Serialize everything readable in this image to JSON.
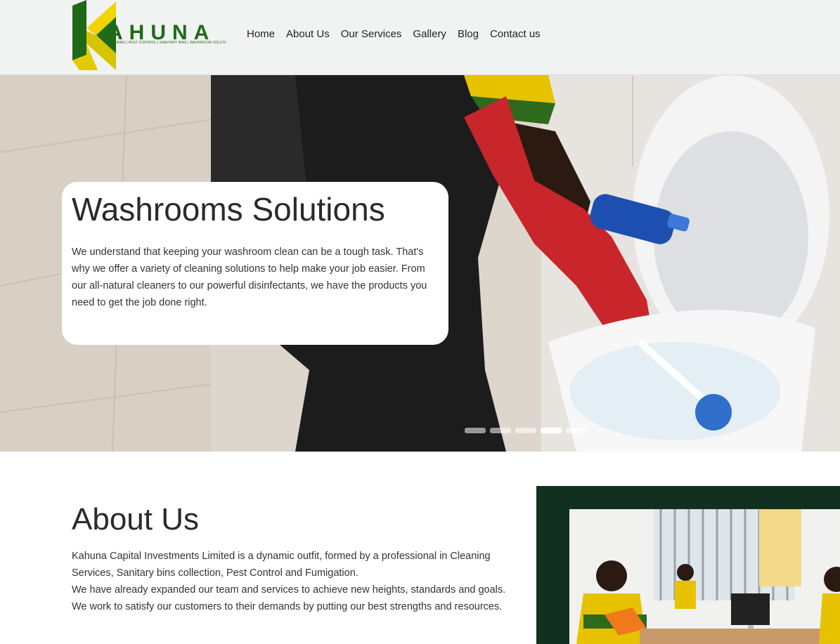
{
  "brand": {
    "name": "AHUNA",
    "tagline": "CLEANING | PEST CONTROL | SANITARY BINS | WASHROOM SOLUTIONS",
    "colors": {
      "green": "#1f6a16",
      "yellow": "#f2d500"
    }
  },
  "nav": {
    "items": [
      {
        "label": "Home"
      },
      {
        "label": "About Us"
      },
      {
        "label": "Our Services"
      },
      {
        "label": "Gallery"
      },
      {
        "label": "Blog"
      },
      {
        "label": "Contact us"
      }
    ]
  },
  "hero": {
    "title": "Washrooms Solutions",
    "text": "We understand that keeping your washroom clean can be a tough task. That's why we offer a variety of cleaning solutions to help make your job easier. From our all-natural cleaners to our powerful disinfectants, we have the products you need to get the job done right.",
    "slides_total": 5,
    "active_slide": 4
  },
  "about": {
    "title": "About Us",
    "paragraphs": [
      "Kahuna Capital Investments Limited is a dynamic outfit, formed by a professional in Cleaning Services, Sanitary bins collection, Pest Control and Fumigation.",
      "We have already expanded our team and services to achieve new heights, standards and goals.",
      "We work to satisfy our customers to their demands by putting our best strengths and resources."
    ]
  }
}
